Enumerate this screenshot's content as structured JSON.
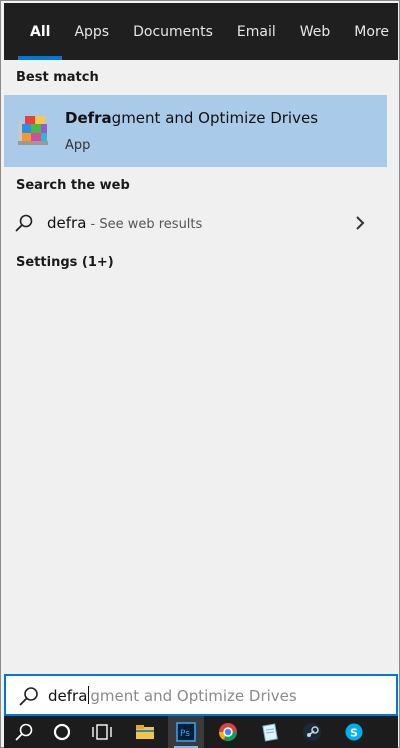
{
  "tabs": [
    {
      "label": "All",
      "active": true
    },
    {
      "label": "Apps"
    },
    {
      "label": "Documents"
    },
    {
      "label": "Email"
    },
    {
      "label": "Web"
    },
    {
      "label": "More"
    }
  ],
  "best_match": {
    "heading": "Best match",
    "title_bold": "Defra",
    "title_rest": "gment and Optimize Drives",
    "subtitle": "App",
    "icon": "defrag-app-icon"
  },
  "web": {
    "heading": "Search the web",
    "query": "defra",
    "hint": " - See web results"
  },
  "settings": {
    "heading": "Settings (1+)"
  },
  "searchbox": {
    "typed": "defra",
    "suggestion": "gment and Optimize Drives"
  },
  "taskbar": {
    "items": [
      "search-icon",
      "cortana-icon",
      "task-view-icon",
      "file-explorer-icon",
      "photoshop-icon",
      "chrome-icon",
      "notepad-icon",
      "steam-icon",
      "skype-icon"
    ]
  },
  "colors": {
    "accent": "#0078d7",
    "selection": "#a9cbe9",
    "tab_bar": "#1f1f1f",
    "taskbar": "#1c1c1c"
  }
}
